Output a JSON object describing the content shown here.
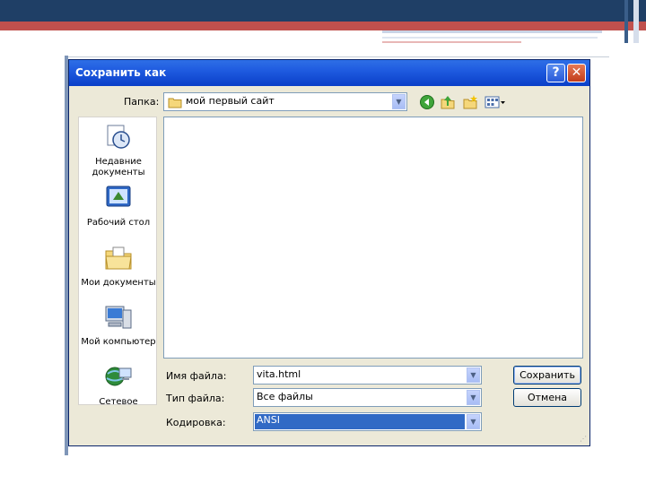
{
  "dialog": {
    "title": "Сохранить как",
    "help_glyph": "?",
    "close_glyph": "✕"
  },
  "folder": {
    "label": "Папка:",
    "value": "мой первый сайт"
  },
  "places": [
    {
      "label": "Недавние документы",
      "icon": "recent-documents-icon"
    },
    {
      "label": "Рабочий стол",
      "icon": "desktop-icon"
    },
    {
      "label": "Мои документы",
      "icon": "my-documents-icon"
    },
    {
      "label": "Мой компьютер",
      "icon": "my-computer-icon"
    },
    {
      "label": "Сетевое",
      "icon": "network-icon"
    }
  ],
  "form": {
    "filename_label": "Имя файла:",
    "filename_value": "vita.html",
    "filetype_label": "Тип файла:",
    "filetype_value": "Все файлы",
    "encoding_label": "Кодировка:",
    "encoding_value": "ANSI"
  },
  "buttons": {
    "save": "Сохранить",
    "cancel": "Отмена"
  },
  "colors": {
    "titlebar": "#0a3fc8",
    "dialog_bg": "#ece9d8",
    "selection": "#316ac5"
  }
}
